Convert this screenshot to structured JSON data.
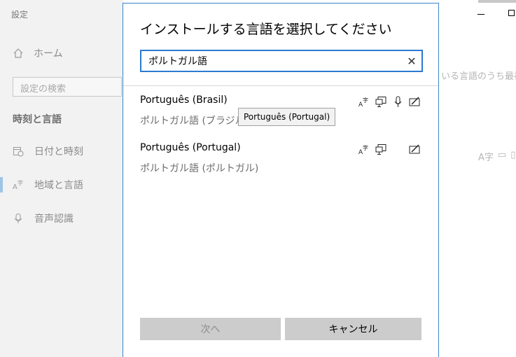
{
  "sidebar": {
    "title": "設定",
    "home": "ホーム",
    "search_placeholder": "設定の検索",
    "section": "時刻と言語",
    "items": [
      {
        "label": "日付と時刻",
        "icon": "calendar-clock-icon"
      },
      {
        "label": "地域と言語",
        "icon": "language-icon"
      },
      {
        "label": "音声認識",
        "icon": "microphone-icon"
      }
    ]
  },
  "background_window": {
    "partial_text": "いる言語のうち最初"
  },
  "dialog": {
    "title": "インストールする言語を選択してください",
    "search_value": "ポルトガル語",
    "clear_glyph": "✕",
    "languages": [
      {
        "name": "Português (Brasil)",
        "subtitle": "ポルトガル語 (ブラジル)",
        "features": [
          "display-language-icon",
          "text-to-speech-icon",
          "speech-recognition-icon",
          "handwriting-icon"
        ]
      },
      {
        "name": "Português (Portugal)",
        "subtitle": "ポルトガル語 (ポルトガル)",
        "features": [
          "display-language-icon",
          "text-to-speech-icon",
          "handwriting-icon"
        ]
      }
    ],
    "tooltip": "Português (Portugal)",
    "next_label": "次へ",
    "cancel_label": "キャンセル"
  },
  "colors": {
    "accent": "#2b7ad0",
    "sidebar_bg": "#f2f2f2",
    "button_bg": "#cccccc"
  }
}
